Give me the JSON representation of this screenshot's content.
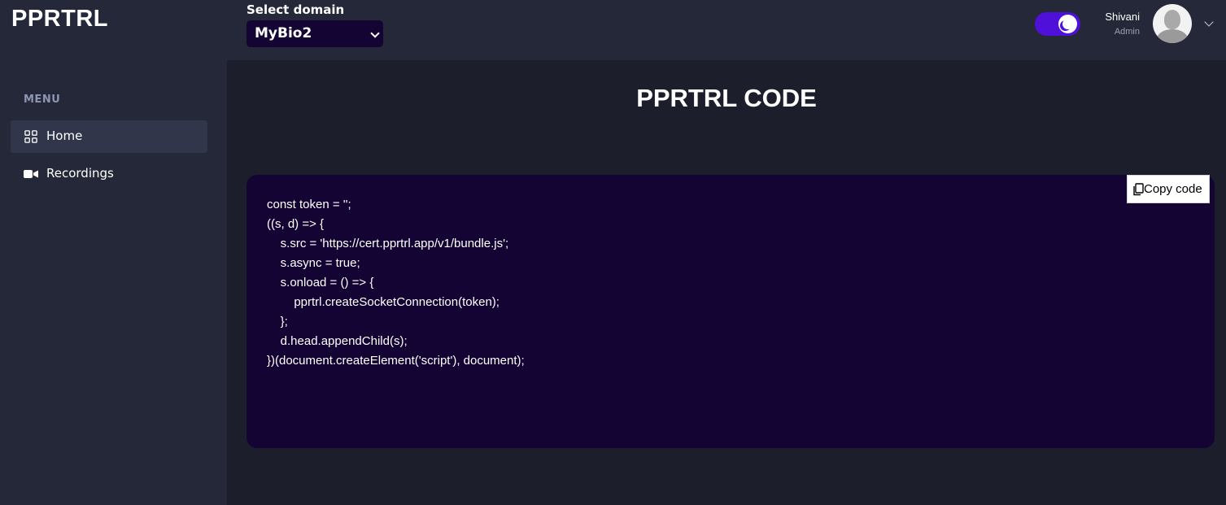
{
  "app": {
    "title": "PPRTRL"
  },
  "header": {
    "domain_label": "Select domain",
    "domain_selected": "MyBio2",
    "theme_toggle_icon": "moon-icon",
    "user": {
      "name": "Shivani",
      "role": "Admin"
    }
  },
  "sidebar": {
    "menu_title": "MENU",
    "items": [
      {
        "label": "Home",
        "icon": "grid-icon",
        "active": true
      },
      {
        "label": "Recordings",
        "icon": "video-icon",
        "active": false
      }
    ]
  },
  "main": {
    "title": "PPRTRL CODE",
    "copy_label": "Copy code",
    "code": "const token = '';\n((s, d) => {\n    s.src = 'https://cert.pprtrl.app/v1/bundle.js';\n    s.async = true;\n    s.onload = () => {\n        pprtrl.createSocketConnection(token);\n    };\n    d.head.appendChild(s);\n})(document.createElement('script'), document);"
  },
  "colors": {
    "header_bg": "#242838",
    "main_bg": "#1c1f2b",
    "code_bg": "#130433",
    "toggle_accent": "#4f10d9"
  }
}
